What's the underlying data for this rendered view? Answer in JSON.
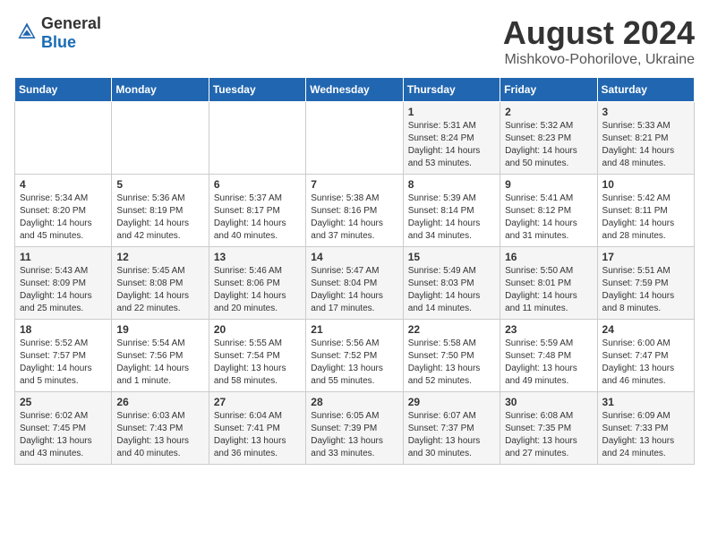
{
  "logo": {
    "general": "General",
    "blue": "Blue"
  },
  "title": "August 2024",
  "subtitle": "Mishkovo-Pohorilove, Ukraine",
  "headers": [
    "Sunday",
    "Monday",
    "Tuesday",
    "Wednesday",
    "Thursday",
    "Friday",
    "Saturday"
  ],
  "weeks": [
    [
      {
        "day": "",
        "info": ""
      },
      {
        "day": "",
        "info": ""
      },
      {
        "day": "",
        "info": ""
      },
      {
        "day": "",
        "info": ""
      },
      {
        "day": "1",
        "info": "Sunrise: 5:31 AM\nSunset: 8:24 PM\nDaylight: 14 hours\nand 53 minutes."
      },
      {
        "day": "2",
        "info": "Sunrise: 5:32 AM\nSunset: 8:23 PM\nDaylight: 14 hours\nand 50 minutes."
      },
      {
        "day": "3",
        "info": "Sunrise: 5:33 AM\nSunset: 8:21 PM\nDaylight: 14 hours\nand 48 minutes."
      }
    ],
    [
      {
        "day": "4",
        "info": "Sunrise: 5:34 AM\nSunset: 8:20 PM\nDaylight: 14 hours\nand 45 minutes."
      },
      {
        "day": "5",
        "info": "Sunrise: 5:36 AM\nSunset: 8:19 PM\nDaylight: 14 hours\nand 42 minutes."
      },
      {
        "day": "6",
        "info": "Sunrise: 5:37 AM\nSunset: 8:17 PM\nDaylight: 14 hours\nand 40 minutes."
      },
      {
        "day": "7",
        "info": "Sunrise: 5:38 AM\nSunset: 8:16 PM\nDaylight: 14 hours\nand 37 minutes."
      },
      {
        "day": "8",
        "info": "Sunrise: 5:39 AM\nSunset: 8:14 PM\nDaylight: 14 hours\nand 34 minutes."
      },
      {
        "day": "9",
        "info": "Sunrise: 5:41 AM\nSunset: 8:12 PM\nDaylight: 14 hours\nand 31 minutes."
      },
      {
        "day": "10",
        "info": "Sunrise: 5:42 AM\nSunset: 8:11 PM\nDaylight: 14 hours\nand 28 minutes."
      }
    ],
    [
      {
        "day": "11",
        "info": "Sunrise: 5:43 AM\nSunset: 8:09 PM\nDaylight: 14 hours\nand 25 minutes."
      },
      {
        "day": "12",
        "info": "Sunrise: 5:45 AM\nSunset: 8:08 PM\nDaylight: 14 hours\nand 22 minutes."
      },
      {
        "day": "13",
        "info": "Sunrise: 5:46 AM\nSunset: 8:06 PM\nDaylight: 14 hours\nand 20 minutes."
      },
      {
        "day": "14",
        "info": "Sunrise: 5:47 AM\nSunset: 8:04 PM\nDaylight: 14 hours\nand 17 minutes."
      },
      {
        "day": "15",
        "info": "Sunrise: 5:49 AM\nSunset: 8:03 PM\nDaylight: 14 hours\nand 14 minutes."
      },
      {
        "day": "16",
        "info": "Sunrise: 5:50 AM\nSunset: 8:01 PM\nDaylight: 14 hours\nand 11 minutes."
      },
      {
        "day": "17",
        "info": "Sunrise: 5:51 AM\nSunset: 7:59 PM\nDaylight: 14 hours\nand 8 minutes."
      }
    ],
    [
      {
        "day": "18",
        "info": "Sunrise: 5:52 AM\nSunset: 7:57 PM\nDaylight: 14 hours\nand 5 minutes."
      },
      {
        "day": "19",
        "info": "Sunrise: 5:54 AM\nSunset: 7:56 PM\nDaylight: 14 hours\nand 1 minute."
      },
      {
        "day": "20",
        "info": "Sunrise: 5:55 AM\nSunset: 7:54 PM\nDaylight: 13 hours\nand 58 minutes."
      },
      {
        "day": "21",
        "info": "Sunrise: 5:56 AM\nSunset: 7:52 PM\nDaylight: 13 hours\nand 55 minutes."
      },
      {
        "day": "22",
        "info": "Sunrise: 5:58 AM\nSunset: 7:50 PM\nDaylight: 13 hours\nand 52 minutes."
      },
      {
        "day": "23",
        "info": "Sunrise: 5:59 AM\nSunset: 7:48 PM\nDaylight: 13 hours\nand 49 minutes."
      },
      {
        "day": "24",
        "info": "Sunrise: 6:00 AM\nSunset: 7:47 PM\nDaylight: 13 hours\nand 46 minutes."
      }
    ],
    [
      {
        "day": "25",
        "info": "Sunrise: 6:02 AM\nSunset: 7:45 PM\nDaylight: 13 hours\nand 43 minutes."
      },
      {
        "day": "26",
        "info": "Sunrise: 6:03 AM\nSunset: 7:43 PM\nDaylight: 13 hours\nand 40 minutes."
      },
      {
        "day": "27",
        "info": "Sunrise: 6:04 AM\nSunset: 7:41 PM\nDaylight: 13 hours\nand 36 minutes."
      },
      {
        "day": "28",
        "info": "Sunrise: 6:05 AM\nSunset: 7:39 PM\nDaylight: 13 hours\nand 33 minutes."
      },
      {
        "day": "29",
        "info": "Sunrise: 6:07 AM\nSunset: 7:37 PM\nDaylight: 13 hours\nand 30 minutes."
      },
      {
        "day": "30",
        "info": "Sunrise: 6:08 AM\nSunset: 7:35 PM\nDaylight: 13 hours\nand 27 minutes."
      },
      {
        "day": "31",
        "info": "Sunrise: 6:09 AM\nSunset: 7:33 PM\nDaylight: 13 hours\nand 24 minutes."
      }
    ]
  ]
}
